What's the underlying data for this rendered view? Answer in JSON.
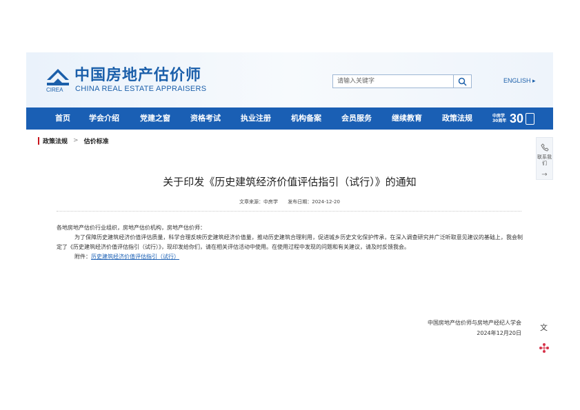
{
  "header": {
    "logo_cn": "中国房地产估价师",
    "logo_abbr": "CIREA",
    "logo_en": "CHINA REAL ESTATE APPRAISERS",
    "search_placeholder": "请输入关键字",
    "english_label": "ENGLISH ▸"
  },
  "nav": {
    "items": [
      {
        "label": "首页"
      },
      {
        "label": "学会介绍"
      },
      {
        "label": "党建之窗"
      },
      {
        "label": "资格考试"
      },
      {
        "label": "执业注册"
      },
      {
        "label": "机构备案"
      },
      {
        "label": "会员服务"
      },
      {
        "label": "继续教育"
      },
      {
        "label": "政策法规"
      }
    ],
    "anniversary_text": "中房学 30周年",
    "anniversary_number": "30"
  },
  "breadcrumb": {
    "parent": "政策法规",
    "separator": ">",
    "current": "估价标准"
  },
  "article": {
    "title": "关于印发《历史建筑经济价值评估指引（试行）》的通知",
    "source": "文章来源：中房学",
    "date": "发布日期：2024-12-20",
    "salutation": "各地房地产估价行业组织，房地产估价机构，房地产估价师：",
    "body": "为了保障历史建筑经济价值评估质量，科学合理反映历史建筑经济价值量，推动历史建筑合理利用，促进城乡历史文化保护传承，在深入调查研究并广泛听取意见建议的基础上，我会制定了《历史建筑经济价值评估指引（试行）》，现印发给你们，请在相关评估活动中使用。在使用过程中发现的问题和有关建议，请及时反馈我会。",
    "attachment_label": "附件：",
    "attachment_link": "历史建筑经济价值评估指引（试行）",
    "sign_org": "中国房地产估价师与房地产经纪人学会",
    "sign_date": "2024年12月20日"
  },
  "float_panel": {
    "contact_label": "联系我们",
    "arrow": "→"
  },
  "colors": {
    "brand_blue": "#1a5fb4",
    "breadcrumb_bar": "#c8151d"
  }
}
